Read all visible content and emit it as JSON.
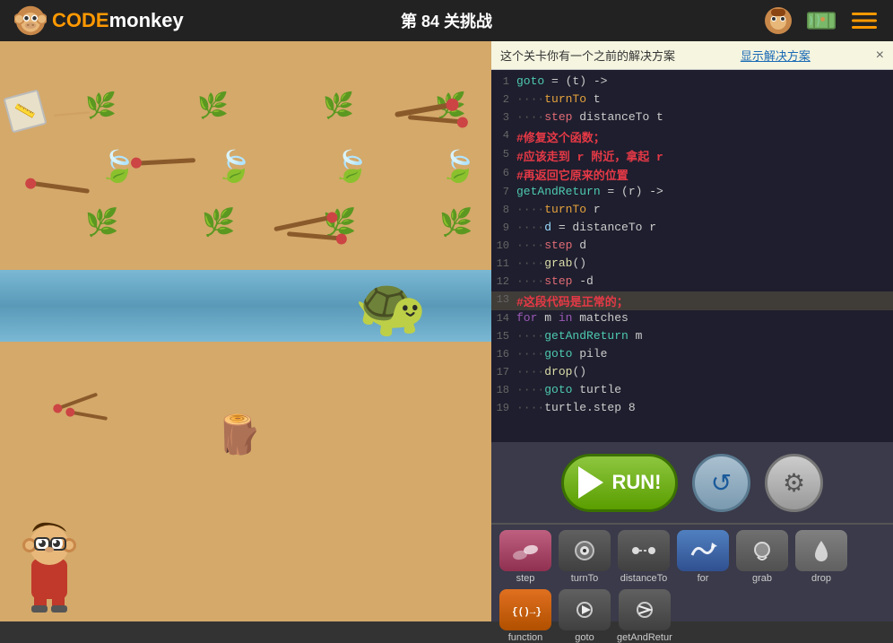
{
  "navbar": {
    "logo_text_code": "CODE",
    "logo_text_monkey": "monkey",
    "level_title": "第 84 关挑战"
  },
  "notice": {
    "text": "这个关卡你有一个之前的解决方案",
    "link_text": "显示解决方案",
    "close": "×"
  },
  "code": {
    "lines": [
      {
        "num": "1",
        "content": "goto = (t) ->",
        "type": "normal"
      },
      {
        "num": "2",
        "content": "    turnTo t",
        "type": "normal"
      },
      {
        "num": "3",
        "content": "    step distanceTo t",
        "type": "normal"
      },
      {
        "num": "4",
        "content": "#修复这个函数；",
        "type": "comment"
      },
      {
        "num": "5",
        "content": "#应该走到 r 附近，拿起 r",
        "type": "comment"
      },
      {
        "num": "6",
        "content": "#再返回它原来的位置",
        "type": "comment"
      },
      {
        "num": "7",
        "content": "getAndReturn = (r) ->",
        "type": "normal"
      },
      {
        "num": "8",
        "content": "    turnTo r",
        "type": "normal"
      },
      {
        "num": "9",
        "content": "    d = distanceTo r",
        "type": "normal"
      },
      {
        "num": "10",
        "content": "    step d",
        "type": "normal"
      },
      {
        "num": "11",
        "content": "    grab()",
        "type": "normal"
      },
      {
        "num": "12",
        "content": "    step -d",
        "type": "normal"
      },
      {
        "num": "13",
        "content": "#这段代码是正常的；",
        "type": "comment-highlight"
      },
      {
        "num": "14",
        "content": "for m in matches",
        "type": "normal"
      },
      {
        "num": "15",
        "content": "    getAndReturn m",
        "type": "normal"
      },
      {
        "num": "16",
        "content": "    goto pile",
        "type": "normal"
      },
      {
        "num": "17",
        "content": "    drop()",
        "type": "normal"
      },
      {
        "num": "18",
        "content": "    goto turtle",
        "type": "normal"
      },
      {
        "num": "19",
        "content": "    turtle.step 8",
        "type": "normal"
      }
    ]
  },
  "run_button": {
    "label": "RUN!"
  },
  "blocks": [
    {
      "id": "step",
      "label": "step",
      "icon_type": "feet"
    },
    {
      "id": "turnto",
      "label": "turnTo",
      "icon_type": "eye"
    },
    {
      "id": "distanceto",
      "label": "distanceTo",
      "icon_type": "dotted"
    },
    {
      "id": "for",
      "label": "for",
      "icon_type": "waves"
    },
    {
      "id": "grab",
      "label": "grab",
      "icon_type": "hand"
    },
    {
      "id": "drop",
      "label": "drop",
      "icon_type": "drop"
    },
    {
      "id": "function",
      "label": "function",
      "icon_type": "func"
    },
    {
      "id": "goto",
      "label": "goto",
      "icon_type": "goto"
    },
    {
      "id": "getandreturn",
      "label": "getAndRetur",
      "icon_type": "getandreturn"
    }
  ]
}
